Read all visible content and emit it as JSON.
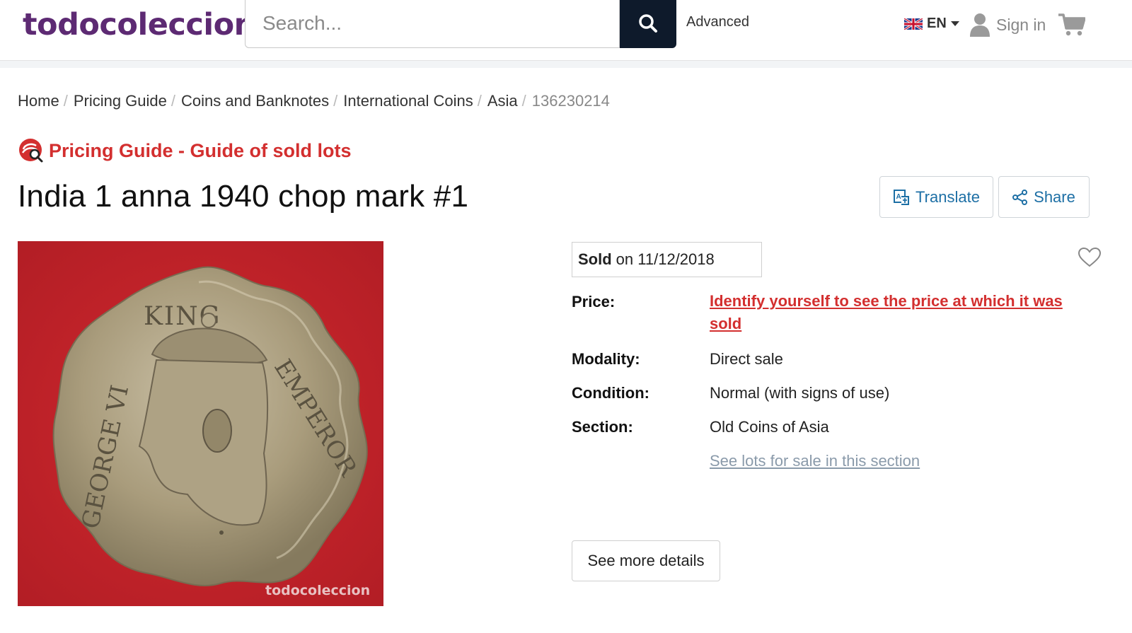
{
  "header": {
    "logo": "todocoleccion",
    "search_placeholder": "Search...",
    "advanced_label": "Advanced",
    "language": "EN",
    "signin_label": "Sign in"
  },
  "breadcrumb": {
    "items": [
      "Home",
      "Pricing Guide",
      "Coins and Banknotes",
      "International Coins",
      "Asia"
    ],
    "current": "136230214"
  },
  "guide_title": "Pricing Guide - Guide of sold lots",
  "title": "India 1 anna 1940 chop mark #1",
  "actions": {
    "translate_label": "Translate",
    "share_label": "Share"
  },
  "image": {
    "inscription": "GEORGE VI KING EMPEROR",
    "watermark": "todocoleccion"
  },
  "details": {
    "sold_label": "Sold",
    "sold_date": "on 11/12/2018",
    "price_label": "Price:",
    "price_link": "Identify yourself to see the price at which it was sold",
    "modality_label": "Modality:",
    "modality_value": "Direct sale",
    "condition_label": "Condition:",
    "condition_value": "Normal (with signs of use)",
    "section_label": "Section:",
    "section_value": "Old Coins of Asia",
    "section_link": "See lots for sale in this section",
    "more_details": "See more details"
  },
  "colors": {
    "brand": "#5d2a73",
    "accent_red": "#d32f2f",
    "search_button": "#0e1a2b",
    "link_blue": "#1d6fa5",
    "coin_background": "#c8242b"
  }
}
